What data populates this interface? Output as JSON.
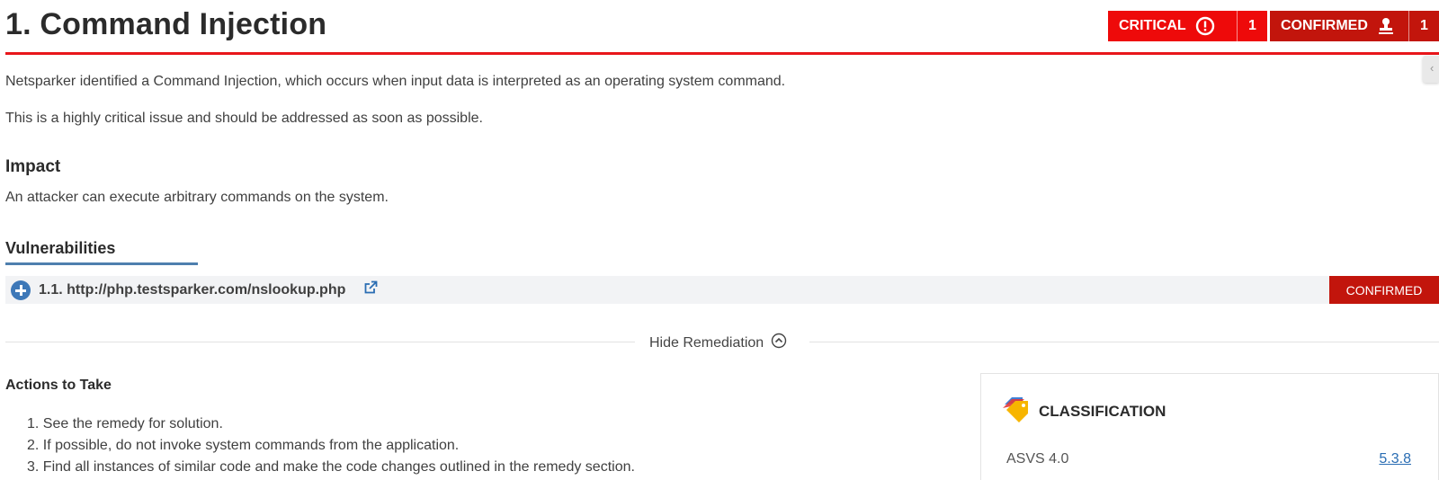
{
  "header": {
    "title": "1. Command Injection",
    "severity_badge": {
      "label": "CRITICAL",
      "count": "1",
      "color": "#ee0a0a",
      "icon": "exclamation-circle-icon"
    },
    "status_badge": {
      "label": "CONFIRMED",
      "count": "1",
      "color": "#c2150c",
      "icon": "stamp-icon"
    }
  },
  "description": {
    "line1": "Netsparker identified a Command Injection, which occurs when input data is interpreted as an operating system command.",
    "line2": "This is a highly critical issue and should be addressed as soon as possible."
  },
  "impact": {
    "heading": "Impact",
    "text": "An attacker can execute arbitrary commands on the system."
  },
  "vulnerabilities": {
    "heading": "Vulnerabilities",
    "items": [
      {
        "label": "1.1. http://php.testsparker.com/nslookup.php",
        "status": "CONFIRMED"
      }
    ]
  },
  "remediation_toggle": {
    "label": "Hide Remediation",
    "icon": "chevron-up-circle-icon"
  },
  "actions": {
    "heading": "Actions to Take",
    "items": [
      "1. See the remedy for solution.",
      "2. If possible, do not invoke system commands from the application.",
      "3. Find all instances of similar code and make the code changes outlined in the remedy section."
    ]
  },
  "classification": {
    "title": "CLASSIFICATION",
    "icon": "tags-icon",
    "rows": [
      {
        "label": "ASVS 4.0",
        "value": "5.3.8"
      }
    ]
  },
  "colors": {
    "accent_red": "#e8161b",
    "link_blue": "#2a6db3",
    "tab_underline": "#4e7fae"
  }
}
